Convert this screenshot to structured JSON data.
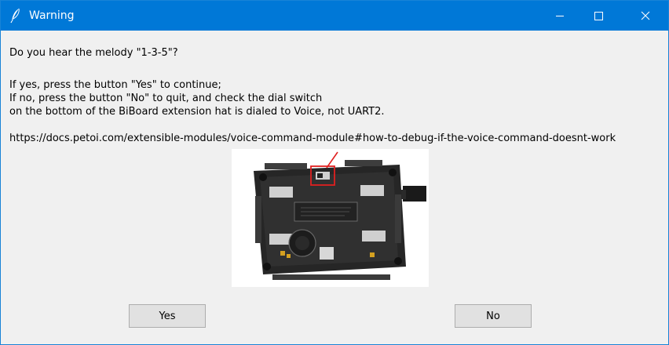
{
  "window": {
    "title": "Warning"
  },
  "message": {
    "question": "Do you hear the melody \"1-3-5\"?",
    "line_yes": "If yes, press the button \"Yes\" to continue;",
    "line_no": "If no, press the button \"No\" to quit, and check the dial switch",
    "line_board": "on the bottom of the BiBoard extension hat is dialed to Voice, not UART2.",
    "link": "https://docs.petoi.com/extensible-modules/voice-command-module#how-to-debug-if-the-voice-command-doesnt-work"
  },
  "buttons": {
    "yes_label": "Yes",
    "no_label": "No"
  },
  "icons": {
    "app": "feather-icon",
    "minimize": "minimize-icon",
    "maximize": "maximize-icon",
    "close": "close-icon"
  },
  "colors": {
    "titlebar": "#0078d7",
    "dialog_bg": "#f0f0f0",
    "button_bg": "#e1e1e1",
    "highlight": "#e02020"
  }
}
